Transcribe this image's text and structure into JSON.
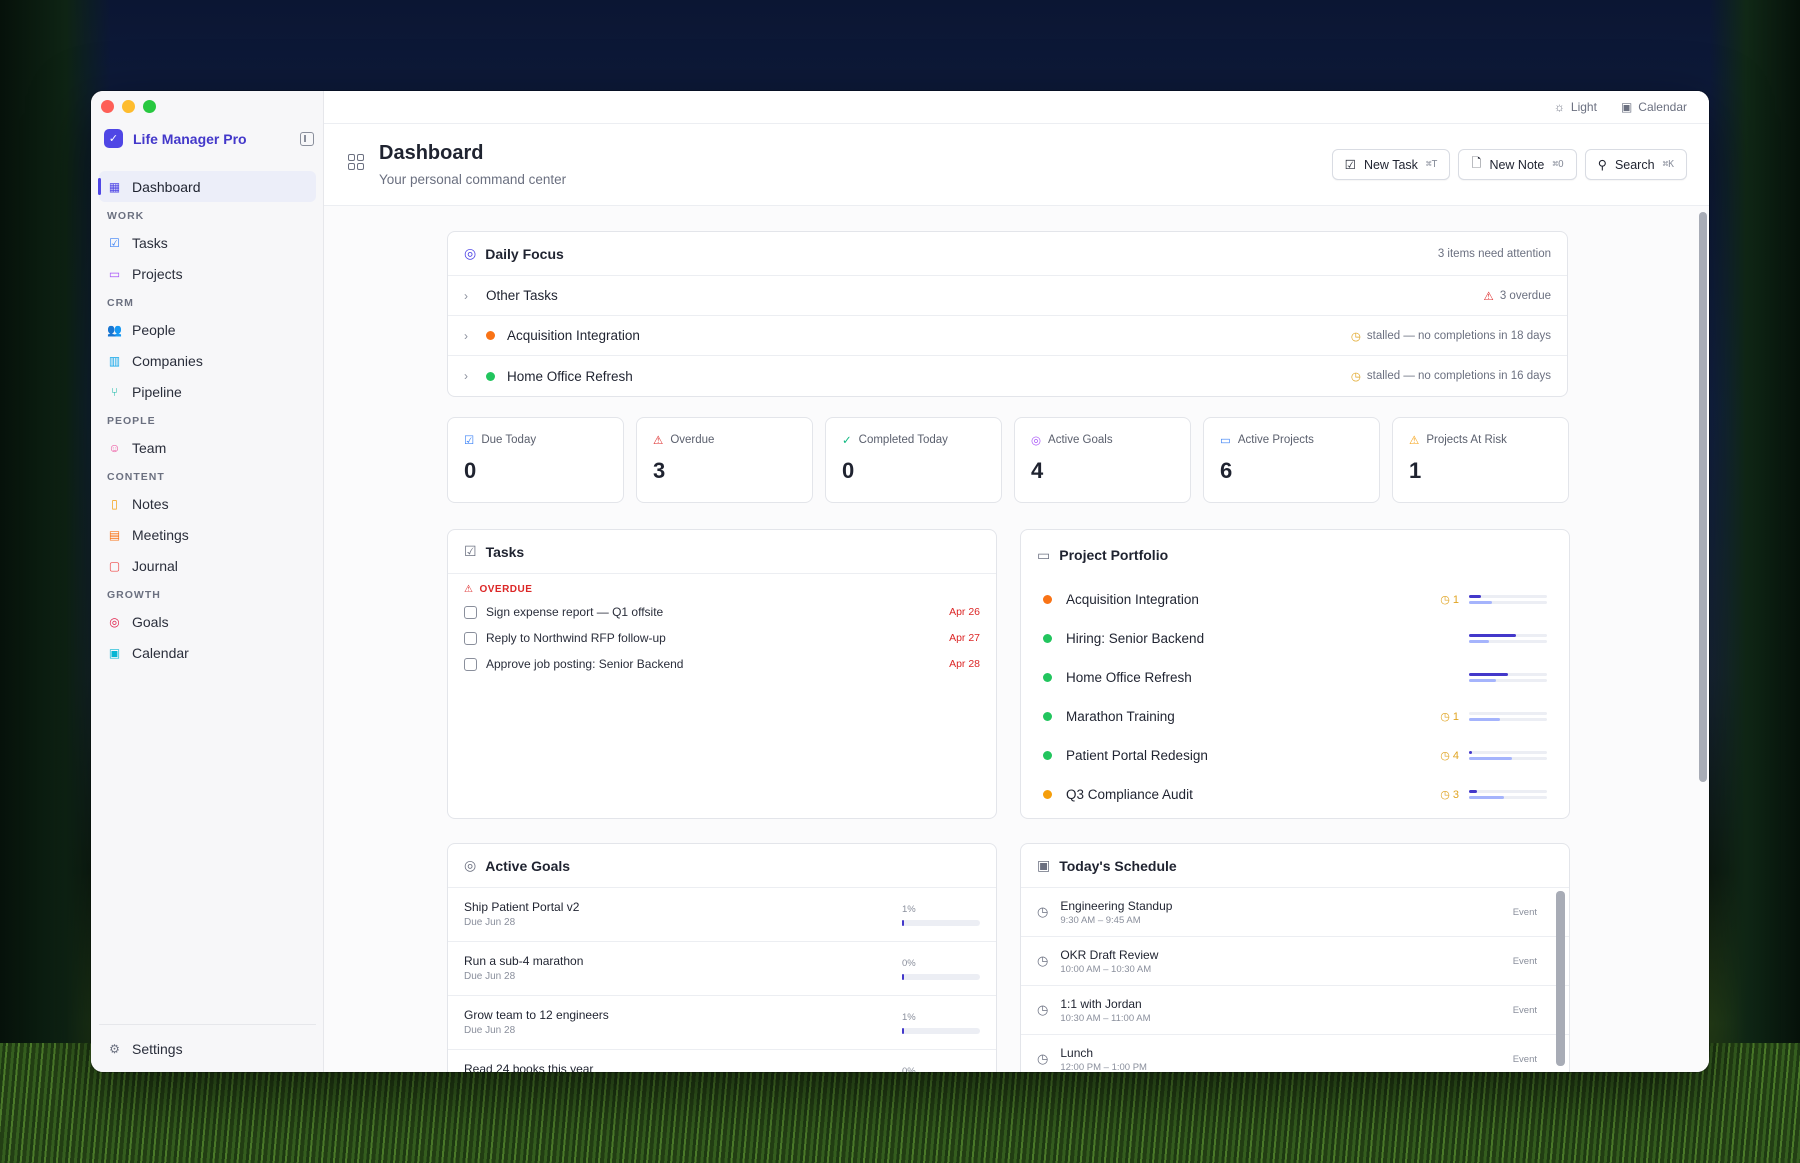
{
  "app": {
    "name": "Life Manager Pro",
    "logo_glyph": "✓"
  },
  "sidebar": {
    "items": [
      {
        "type": "item",
        "label": "Dashboard",
        "icon": "grid-icon",
        "color": "#4f46e5",
        "active": true
      },
      {
        "type": "section",
        "label": "WORK"
      },
      {
        "type": "item",
        "label": "Tasks",
        "icon": "check-square-icon",
        "color": "#3b82f6"
      },
      {
        "type": "item",
        "label": "Projects",
        "icon": "folder-icon",
        "color": "#a855f7"
      },
      {
        "type": "section",
        "label": "CRM"
      },
      {
        "type": "item",
        "label": "People",
        "icon": "users-icon",
        "color": "#10b981"
      },
      {
        "type": "item",
        "label": "Companies",
        "icon": "building-icon",
        "color": "#0ea5e9"
      },
      {
        "type": "item",
        "label": "Pipeline",
        "icon": "git-branch-icon",
        "color": "#14b8a6"
      },
      {
        "type": "section",
        "label": "PEOPLE"
      },
      {
        "type": "item",
        "label": "Team",
        "icon": "user-icon",
        "color": "#ec4899"
      },
      {
        "type": "section",
        "label": "CONTENT"
      },
      {
        "type": "item",
        "label": "Notes",
        "icon": "file-icon",
        "color": "#f59e0b"
      },
      {
        "type": "item",
        "label": "Meetings",
        "icon": "notebook-icon",
        "color": "#f97316"
      },
      {
        "type": "item",
        "label": "Journal",
        "icon": "book-icon",
        "color": "#ef4444"
      },
      {
        "type": "section",
        "label": "GROWTH"
      },
      {
        "type": "item",
        "label": "Goals",
        "icon": "target-icon",
        "color": "#e11d48"
      },
      {
        "type": "item",
        "label": "Calendar",
        "icon": "calendar-icon",
        "color": "#06b6d4"
      }
    ],
    "settings_label": "Settings"
  },
  "topbar": {
    "theme_label": "Light",
    "calendar_label": "Calendar"
  },
  "header": {
    "title": "Dashboard",
    "subtitle": "Your personal command center",
    "new_task_label": "New Task",
    "new_task_kbd": "⌘T",
    "new_note_label": "New Note",
    "new_note_kbd": "⌘O",
    "search_label": "Search",
    "search_kbd": "⌘K"
  },
  "daily_focus": {
    "title": "Daily Focus",
    "attention": "3 items need attention",
    "rows": [
      {
        "label": "Other Tasks",
        "dot": "",
        "status": "3 overdue",
        "status_icon": "warning-icon",
        "status_color": "#dc2626"
      },
      {
        "label": "Acquisition Integration",
        "dot": "#f97316",
        "status": "stalled — no completions in 18 days",
        "status_icon": "clock-icon",
        "status_color": "#e0a422"
      },
      {
        "label": "Home Office Refresh",
        "dot": "#22c55e",
        "status": "stalled — no completions in 16 days",
        "status_icon": "clock-icon",
        "status_color": "#e0a422"
      }
    ]
  },
  "stats": [
    {
      "label": "Due Today",
      "value": "0",
      "icon": "check-square-icon",
      "color": "#3b82f6"
    },
    {
      "label": "Overdue",
      "value": "3",
      "icon": "warning-icon",
      "color": "#dc2626"
    },
    {
      "label": "Completed Today",
      "value": "0",
      "icon": "check-circle-icon",
      "color": "#10b981"
    },
    {
      "label": "Active Goals",
      "value": "4",
      "icon": "target-icon",
      "color": "#a855f7"
    },
    {
      "label": "Active Projects",
      "value": "6",
      "icon": "folder-icon",
      "color": "#3b82f6"
    },
    {
      "label": "Projects At Risk",
      "value": "1",
      "icon": "warning-icon",
      "color": "#f59e0b"
    }
  ],
  "tasks": {
    "title": "Tasks",
    "overdue_label": "OVERDUE",
    "items": [
      {
        "label": "Sign expense report — Q1 offsite",
        "date": "Apr 26"
      },
      {
        "label": "Reply to Northwind RFP follow-up",
        "date": "Apr 27"
      },
      {
        "label": "Approve job posting: Senior Backend",
        "date": "Apr 28"
      }
    ]
  },
  "portfolio": {
    "title": "Project Portfolio",
    "projects": [
      {
        "name": "Acquisition Integration",
        "dot": "#f97316",
        "warn": "1",
        "primary": 0.15,
        "secondary": 0.3
      },
      {
        "name": "Hiring: Senior Backend",
        "dot": "#22c55e",
        "warn": "",
        "primary": 0.6,
        "secondary": 0.25
      },
      {
        "name": "Home Office Refresh",
        "dot": "#22c55e",
        "warn": "",
        "primary": 0.5,
        "secondary": 0.35
      },
      {
        "name": "Marathon Training",
        "dot": "#22c55e",
        "warn": "1",
        "primary": 0.0,
        "secondary": 0.4
      },
      {
        "name": "Patient Portal Redesign",
        "dot": "#22c55e",
        "warn": "4",
        "primary": 0.04,
        "secondary": 0.55
      },
      {
        "name": "Q3 Compliance Audit",
        "dot": "#f59e0b",
        "warn": "3",
        "primary": 0.1,
        "secondary": 0.45
      }
    ]
  },
  "goals": {
    "title": "Active Goals",
    "items": [
      {
        "name": "Ship Patient Portal v2",
        "due": "Due Jun 28",
        "pct": "1%",
        "progress": 0.01
      },
      {
        "name": "Run a sub-4 marathon",
        "due": "Due Jun 28",
        "pct": "0%",
        "progress": 0.0
      },
      {
        "name": "Grow team to 12 engineers",
        "due": "Due Jun 28",
        "pct": "1%",
        "progress": 0.01
      },
      {
        "name": "Read 24 books this year",
        "due": "",
        "pct": "0%",
        "progress": 0.0
      }
    ]
  },
  "schedule": {
    "title": "Today's Schedule",
    "events": [
      {
        "name": "Engineering Standup",
        "time": "9:30 AM – 9:45 AM",
        "tag": "Event"
      },
      {
        "name": "OKR Draft Review",
        "time": "10:00 AM – 10:30 AM",
        "tag": "Event"
      },
      {
        "name": "1:1 with Jordan",
        "time": "10:30 AM – 11:00 AM",
        "tag": "Event"
      },
      {
        "name": "Lunch",
        "time": "12:00 PM – 1:00 PM",
        "tag": "Event"
      }
    ]
  }
}
